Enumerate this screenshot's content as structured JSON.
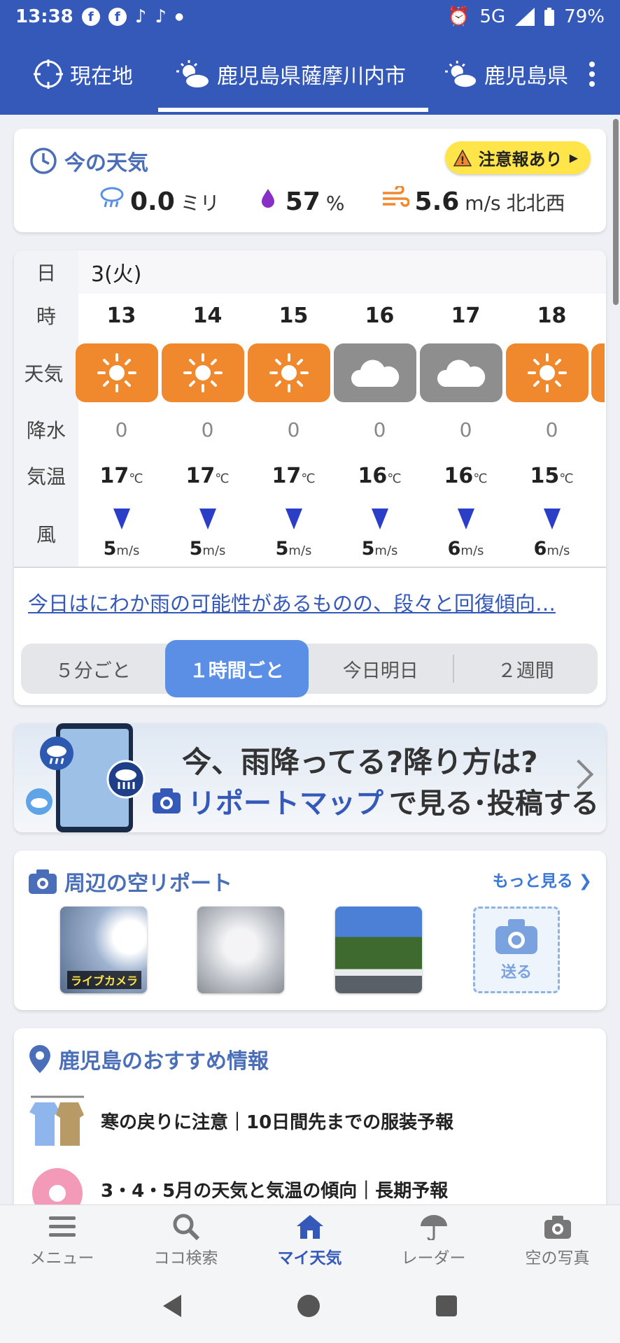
{
  "status_bar": {
    "time": "13:38",
    "network": "5G",
    "battery": "79%"
  },
  "tabs": [
    {
      "label": "現在地",
      "icon": "crosshair-icon"
    },
    {
      "label": "鹿児島県薩摩川内市",
      "icon": "sun-cloud-icon",
      "active": true
    },
    {
      "label": "鹿児島県",
      "icon": "sun-cloud-icon"
    }
  ],
  "current_weather": {
    "title": "今の天気",
    "alert_badge": "注意報あり",
    "precip_value": "0.0",
    "precip_unit": "ミリ",
    "humidity_value": "57",
    "humidity_unit": "%",
    "wind_value": "5.6",
    "wind_unit": "m/s",
    "wind_direction": "北北西"
  },
  "forecast": {
    "day_label": "日",
    "day_value": "3(火)",
    "row_labels": {
      "hour": "時",
      "weather": "天気",
      "precip": "降水",
      "temp": "気温",
      "wind": "風"
    },
    "temp_unit": "℃",
    "wind_unit": "m/s",
    "hours": [
      {
        "hour": "13",
        "weather": "sunny",
        "precip": "0",
        "temp": "17",
        "wind": "5"
      },
      {
        "hour": "14",
        "weather": "sunny",
        "precip": "0",
        "temp": "17",
        "wind": "5"
      },
      {
        "hour": "15",
        "weather": "sunny",
        "precip": "0",
        "temp": "17",
        "wind": "5"
      },
      {
        "hour": "16",
        "weather": "cloudy",
        "precip": "0",
        "temp": "16",
        "wind": "5"
      },
      {
        "hour": "17",
        "weather": "cloudy",
        "precip": "0",
        "temp": "16",
        "wind": "6"
      },
      {
        "hour": "18",
        "weather": "sunny",
        "precip": "0",
        "temp": "15",
        "wind": "6"
      }
    ],
    "summary_link": "今日はにわか雨の可能性があるものの、段々と回復傾向…",
    "segments": [
      "５分ごと",
      "１時間ごと",
      "今日明日",
      "２週間"
    ]
  },
  "banner": {
    "line1": "今、雨降ってる?降り方は?",
    "line2_highlight": "リポートマップ",
    "line2_rest": "で見る･投稿する"
  },
  "sky_report": {
    "title": "周辺の空リポート",
    "more_link": "もっと見る",
    "live_camera_label": "ライブカメラ",
    "send_label": "送る"
  },
  "recommended": {
    "title": "鹿児島のおすすめ情報",
    "items": [
      "寒の戻りに注意｜10日間先までの服装予報",
      "3・4・5月の天気と気温の傾向｜長期予報"
    ]
  },
  "bottom_nav": [
    {
      "label": "メニュー",
      "icon": "menu-icon"
    },
    {
      "label": "ココ検索",
      "icon": "search-icon"
    },
    {
      "label": "マイ天気",
      "icon": "home-icon",
      "active": true
    },
    {
      "label": "レーダー",
      "icon": "umbrella-icon"
    },
    {
      "label": "空の写真",
      "icon": "camera-icon"
    }
  ],
  "colors": {
    "header_blue": "#3559b9",
    "sunny_tile": "#f0892e",
    "cloudy_tile": "#8e8e8e",
    "alert_yellow": "#ffe54a"
  }
}
